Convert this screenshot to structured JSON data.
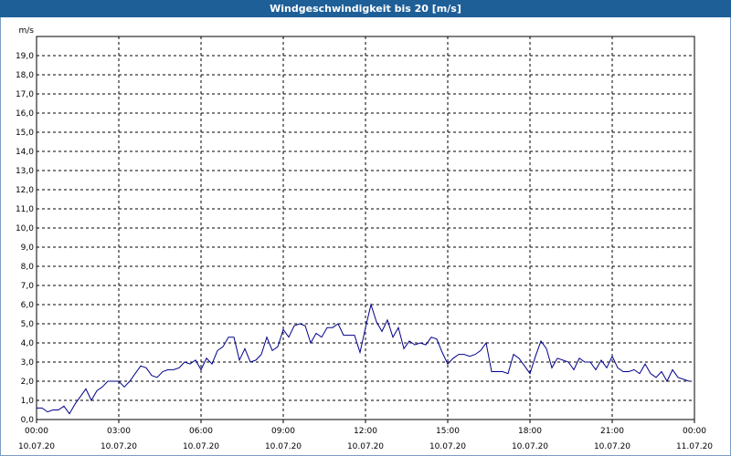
{
  "window": {
    "title": "Windgeschwindigkeit bis 20 [m/s]"
  },
  "chart_data": {
    "type": "line",
    "title": "Windgeschwindigkeit bis 20 [m/s]",
    "ylabel": "m/s",
    "xlabel": "",
    "ylim": [
      0,
      20
    ],
    "xlim_hours": [
      0,
      24
    ],
    "grid": true,
    "line_color": "#00008b",
    "y_ticks": [
      "0,0",
      "1,0",
      "2,0",
      "3,0",
      "4,0",
      "5,0",
      "6,0",
      "7,0",
      "8,0",
      "9,0",
      "10,0",
      "11,0",
      "12,0",
      "13,0",
      "14,0",
      "15,0",
      "16,0",
      "17,0",
      "18,0",
      "19,0"
    ],
    "x_ticks": [
      {
        "time": "00:00",
        "date": "10.07.20"
      },
      {
        "time": "03:00",
        "date": "10.07.20"
      },
      {
        "time": "06:00",
        "date": "10.07.20"
      },
      {
        "time": "09:00",
        "date": "10.07.20"
      },
      {
        "time": "12:00",
        "date": "10.07.20"
      },
      {
        "time": "15:00",
        "date": "10.07.20"
      },
      {
        "time": "18:00",
        "date": "10.07.20"
      },
      {
        "time": "21:00",
        "date": "10.07.20"
      },
      {
        "time": "00:00",
        "date": "11.07.20"
      }
    ],
    "series": [
      {
        "x_hours": [
          0.0,
          0.2,
          0.4,
          0.6,
          0.8,
          1.0,
          1.2,
          1.4,
          1.6,
          1.8,
          2.0,
          2.2,
          2.4,
          2.6,
          2.8,
          3.0,
          3.2,
          3.4,
          3.6,
          3.8,
          4.0,
          4.2,
          4.4,
          4.6,
          4.8,
          5.0,
          5.2,
          5.4,
          5.6,
          5.8,
          6.0,
          6.2,
          6.4,
          6.6,
          6.8,
          7.0,
          7.2,
          7.4,
          7.6,
          7.8,
          8.0,
          8.2,
          8.4,
          8.6,
          8.8,
          9.0,
          9.2,
          9.4,
          9.6,
          9.8,
          10.0,
          10.2,
          10.4,
          10.6,
          10.8,
          11.0,
          11.2,
          11.4,
          11.6,
          11.8,
          12.0,
          12.2,
          12.4,
          12.6,
          12.8,
          13.0,
          13.2,
          13.4,
          13.6,
          13.8,
          14.0,
          14.2,
          14.4,
          14.6,
          14.8,
          15.0,
          15.2,
          15.4,
          15.6,
          15.8,
          16.0,
          16.2,
          16.4,
          16.6,
          16.8,
          17.0,
          17.2,
          17.4,
          17.6,
          17.8,
          18.0,
          18.2,
          18.4,
          18.6,
          18.8,
          19.0,
          19.2,
          19.4,
          19.6,
          19.8,
          20.0,
          20.2,
          20.4,
          20.6,
          20.8,
          21.0,
          21.2,
          21.4,
          21.6,
          21.8,
          22.0,
          22.2,
          22.4,
          22.6,
          22.8,
          23.0,
          23.2,
          23.4,
          23.6,
          23.8
        ],
        "values": [
          0.6,
          0.6,
          0.4,
          0.5,
          0.5,
          0.7,
          0.3,
          0.8,
          1.2,
          1.6,
          1.0,
          1.5,
          1.7,
          2.0,
          2.0,
          2.0,
          1.7,
          2.0,
          2.4,
          2.8,
          2.7,
          2.3,
          2.2,
          2.5,
          2.6,
          2.6,
          2.7,
          3.0,
          2.9,
          3.1,
          2.6,
          3.2,
          2.9,
          3.6,
          3.8,
          4.3,
          4.3,
          3.1,
          3.7,
          3.0,
          3.1,
          3.4,
          4.3,
          3.6,
          3.8,
          4.7,
          4.3,
          4.9,
          5.0,
          4.9,
          4.0,
          4.5,
          4.3,
          4.8,
          4.8,
          5.0,
          4.4,
          4.4,
          4.4,
          3.5,
          4.8,
          6.0,
          5.1,
          4.6,
          5.2,
          4.3,
          4.8,
          3.7,
          4.1,
          3.9,
          4.0,
          3.9,
          4.3,
          4.2,
          3.5,
          2.9,
          3.2,
          3.4,
          3.4,
          3.3,
          3.4,
          3.6,
          4.0,
          2.5,
          2.5,
          2.5,
          2.4,
          3.4,
          3.2,
          2.8,
          2.4,
          3.3,
          4.1,
          3.7,
          2.7,
          3.2,
          3.1,
          3.0,
          2.6,
          3.2,
          3.0,
          3.0,
          2.6,
          3.1,
          2.7,
          3.3,
          2.7,
          2.5,
          2.5,
          2.6,
          2.4,
          2.9,
          2.4,
          2.2,
          2.5,
          2.0,
          2.6,
          2.2,
          2.1,
          2.0,
          1.9,
          2.1
        ]
      }
    ]
  }
}
